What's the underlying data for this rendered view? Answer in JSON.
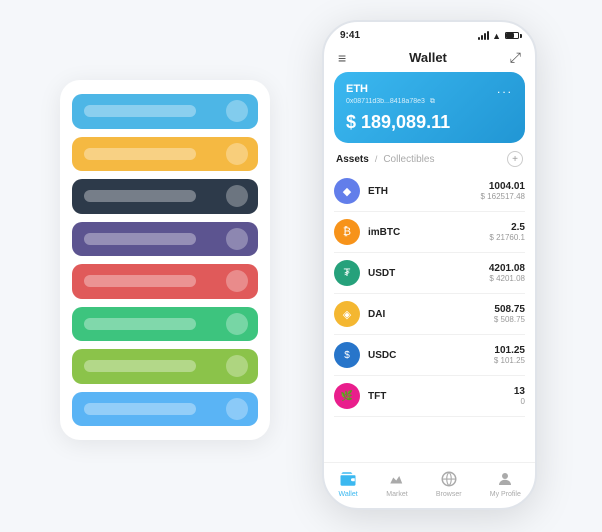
{
  "phone": {
    "status_bar": {
      "time": "9:41",
      "signal": "signal",
      "wifi": "wifi",
      "battery": "battery"
    },
    "nav": {
      "menu_icon": "≡",
      "title": "Wallet",
      "expand_icon": "⤢"
    },
    "eth_card": {
      "label": "ETH",
      "more": "...",
      "address": "0x08711d3b...8418a78e3",
      "copy_icon": "⧉",
      "amount": "$ 189,089.11"
    },
    "assets": {
      "tab_active": "Assets",
      "divider": "/",
      "tab_inactive": "Collectibles",
      "add_icon": "+"
    },
    "tokens": [
      {
        "icon_bg": "#627eea",
        "icon_text": "◆",
        "name": "ETH",
        "amount": "1004.01",
        "usd": "$ 162517.48"
      },
      {
        "icon_bg": "#f7931a",
        "icon_text": "₿",
        "name": "imBTC",
        "amount": "2.5",
        "usd": "$ 21760.1"
      },
      {
        "icon_bg": "#26a17b",
        "icon_text": "₮",
        "name": "USDT",
        "amount": "4201.08",
        "usd": "$ 4201.08"
      },
      {
        "icon_bg": "#f4b731",
        "icon_text": "◈",
        "name": "DAI",
        "amount": "508.75",
        "usd": "$ 508.75"
      },
      {
        "icon_bg": "#2775ca",
        "icon_text": "$",
        "name": "USDC",
        "amount": "101.25",
        "usd": "$ 101.25"
      },
      {
        "icon_bg": "#e91e8c",
        "icon_text": "🌿",
        "name": "TFT",
        "amount": "13",
        "usd": "0"
      }
    ],
    "bottom_tabs": [
      {
        "label": "Wallet",
        "active": true,
        "icon": "wallet"
      },
      {
        "label": "Market",
        "active": false,
        "icon": "chart"
      },
      {
        "label": "Browser",
        "active": false,
        "icon": "browser"
      },
      {
        "label": "My Profile",
        "active": false,
        "icon": "profile"
      }
    ]
  },
  "bg_panel": {
    "bars": [
      {
        "color": "#4db6e6",
        "label": "bar1"
      },
      {
        "color": "#f5b942",
        "label": "bar2"
      },
      {
        "color": "#2d3a4a",
        "label": "bar3"
      },
      {
        "color": "#5c5490",
        "label": "bar4"
      },
      {
        "color": "#e05a5a",
        "label": "bar5"
      },
      {
        "color": "#3dc47e",
        "label": "bar6"
      },
      {
        "color": "#8bc34a",
        "label": "bar7"
      },
      {
        "color": "#5ab4f5",
        "label": "bar8"
      }
    ]
  }
}
